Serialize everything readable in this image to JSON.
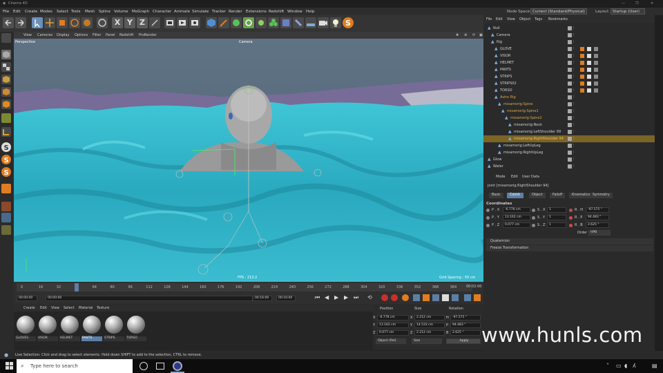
{
  "window": {
    "title": "Cinema 4D"
  },
  "menubar": {
    "items": [
      "File",
      "Edit",
      "Create",
      "Modes",
      "Select",
      "Tools",
      "Mesh",
      "Spline",
      "Volume",
      "MoGraph",
      "Character",
      "Animate",
      "Simulate",
      "Tracker",
      "Render",
      "Extensions",
      "Redshift",
      "Window",
      "Help"
    ],
    "node_space_label": "Node Space:",
    "node_space_value": "Current (Standard/Physical)",
    "layout_label": "Layout:",
    "layout_value": "Startup (User)"
  },
  "viewport": {
    "menu": [
      "View",
      "Cameras",
      "Display",
      "Options",
      "Filter",
      "Panel",
      "Redshift",
      "ProRender"
    ],
    "name": "Perspective",
    "camera": "Camera",
    "fps": "FPS : 213.2",
    "grid_spacing": "Grid Spacing : 50 cm"
  },
  "timeline": {
    "ticks": [
      "0",
      "16",
      "32",
      "48",
      "64",
      "80",
      "96",
      "112",
      "128",
      "144",
      "160",
      "176",
      "192",
      "208",
      "224",
      "240",
      "256",
      "272",
      "288",
      "304",
      "320",
      "336",
      "352",
      "368",
      "384"
    ],
    "current_frame": "00:02:00",
    "start": "00:00:00",
    "start2": "00:00:00",
    "end": "00:16:00",
    "end2": "00:16:00"
  },
  "materials": {
    "menu": [
      "Create",
      "Edit",
      "View",
      "Select",
      "Material",
      "Texture"
    ],
    "items": [
      "GLOVES",
      "VISOR",
      "HELMET",
      "PANTS",
      "STRIPS",
      "TORSO"
    ],
    "selected": "PANTS"
  },
  "coordinates": {
    "headers": {
      "position": "Position",
      "size": "Size",
      "rotation": "Rotation"
    },
    "rows": [
      {
        "axis": "X",
        "position": "-6.778 cm",
        "size": "2.212 cm",
        "rot_axis": "H",
        "rotation": "-97.575 °"
      },
      {
        "axis": "Y",
        "position": "13.162 cm",
        "size": "14.533 cm",
        "rot_axis": "P",
        "rotation": "94.483 °"
      },
      {
        "axis": "Z",
        "position": "0.077 cm",
        "size": "2.212 cm",
        "rot_axis": "B",
        "rotation": "2.625 °"
      }
    ],
    "mode_select": "Object (Rel)",
    "size_select": "Size",
    "apply_label": "Apply"
  },
  "object_manager": {
    "menu": [
      "File",
      "Edit",
      "View",
      "Object",
      "Tags",
      "Bookmarks"
    ],
    "rows": [
      {
        "name": "Null",
        "indent": 0,
        "color": "#d0d0d0"
      },
      {
        "name": "Camera",
        "indent": 1,
        "color": "#d0d0d0"
      },
      {
        "name": "Rig",
        "indent": 1,
        "color": "#d0d0d0"
      },
      {
        "name": "GLOVE",
        "indent": 2,
        "color": "#d0d0d0"
      },
      {
        "name": "VISOR",
        "indent": 2,
        "color": "#d0d0d0"
      },
      {
        "name": "HELMET",
        "indent": 2,
        "color": "#d0d0d0"
      },
      {
        "name": "PANTS",
        "indent": 2,
        "color": "#d0d0d0"
      },
      {
        "name": "STRIPS",
        "indent": 2,
        "color": "#d0d0d0"
      },
      {
        "name": "STRIPS02",
        "indent": 2,
        "color": "#d0d0d0"
      },
      {
        "name": "TORSO",
        "indent": 2,
        "color": "#d0d0d0"
      },
      {
        "name": "Astro Rig",
        "indent": 2,
        "color": "#d8a94a"
      },
      {
        "name": "mixamorig:Spine",
        "indent": 3,
        "color": "#d8a94a"
      },
      {
        "name": "mixamorig:Spine1",
        "indent": 4,
        "color": "#d8a94a"
      },
      {
        "name": "mixamorig:Spine2",
        "indent": 5,
        "color": "#d8a94a"
      },
      {
        "name": "mixamorig:Neck",
        "indent": 6,
        "color": "#d0d0d0"
      },
      {
        "name": "mixamorig:LeftShoulder 99",
        "indent": 6,
        "color": "#d0d0d0"
      },
      {
        "name": "mixamorig:RightShoulder 94",
        "indent": 6,
        "color": "#f0c060",
        "selected": true
      },
      {
        "name": "mixamorig:LeftUpLeg",
        "indent": 3,
        "color": "#d0d0d0"
      },
      {
        "name": "mixamorig:RightUpLeg",
        "indent": 3,
        "color": "#d0d0d0"
      },
      {
        "name": "Glow",
        "indent": 0,
        "color": "#d0d0d0"
      },
      {
        "name": "Water",
        "indent": 0,
        "color": "#d0d0d0"
      }
    ]
  },
  "attributes": {
    "menu": [
      "Mode",
      "Edit",
      "User Data"
    ],
    "object_label": "Joint [mixamorig:RightShoulder 94]",
    "tabs": [
      "Basic",
      "Coord.",
      "Object",
      "Falloff",
      "Kinematics",
      "Symmetry"
    ],
    "active_tab": "Coord.",
    "section": "Coordinates",
    "rows": [
      {
        "p_axis": "P . X",
        "p_value": "-6.778 cm",
        "s_axis": "S . X",
        "s_value": "1",
        "r_axis": "R . H",
        "r_value": "-97.575 °"
      },
      {
        "p_axis": "P . Y",
        "p_value": "13.162 cm",
        "s_axis": "S . Y",
        "s_value": "1",
        "r_axis": "R . P",
        "r_value": "94.483 °"
      },
      {
        "p_axis": "P . Z",
        "p_value": "0.077 cm",
        "s_axis": "S . Z",
        "s_value": "1",
        "r_axis": "R . B",
        "r_value": "2.625 °"
      }
    ],
    "order_label": "Order",
    "order_value": "HPB",
    "collapsed": [
      "Quaternion",
      "Freeze Transformation"
    ]
  },
  "status": {
    "text": "Live Selection: Click and drag to select elements. Hold down SHIFT to add to the selection, CTRL to remove."
  },
  "taskbar": {
    "search_placeholder": "Type here to search"
  },
  "watermark": "www.hunls.com",
  "colors": {
    "water": "#2fb4c8",
    "accent": "#5b7fa6",
    "selected_row": "#7a6426"
  }
}
